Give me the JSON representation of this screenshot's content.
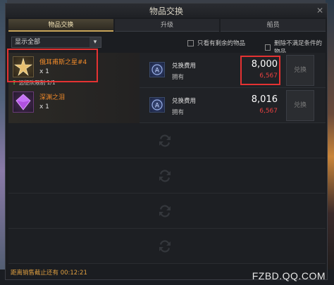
{
  "window": {
    "title": "物品交换",
    "close_icon": "close-icon"
  },
  "tabs": [
    {
      "label": "物品交换",
      "active": true
    },
    {
      "label": "升级",
      "active": false
    },
    {
      "label": "船员",
      "active": false
    }
  ],
  "filter": {
    "dropdown_value": "显示全部",
    "chevron_icon": "chevron-down-icon",
    "only_remaining_label": "只看有剩余的物品",
    "hide_unmet_label": "删除不满足条件的物品"
  },
  "items": [
    {
      "name": "俄耳甫斯之星#4",
      "icon": "gold-star-icon",
      "quantity": "x 1",
      "limit_text": "远征队限制 1/1",
      "cost_label": "兑换费用",
      "own_label": "拥有",
      "cost_value": "8,000",
      "own_value": "6,567",
      "currency_icon": "currency-icon",
      "button_label": "兑换"
    },
    {
      "name": "深渊之泪",
      "icon": "purple-gem-icon",
      "quantity": "x 1",
      "limit_text": "",
      "cost_label": "兑换费用",
      "own_label": "拥有",
      "cost_value": "8,016",
      "own_value": "6,567",
      "currency_icon": "currency-icon",
      "button_label": "兑换"
    }
  ],
  "footer": {
    "countdown": "距离销售截止还有 00:12:21",
    "watermark": "FZBD.QQ.COM"
  },
  "colors": {
    "highlight": "#e53232",
    "item_name": "#f08a2a",
    "own_value": "#e84040",
    "tab_active": "#c8a45a"
  }
}
